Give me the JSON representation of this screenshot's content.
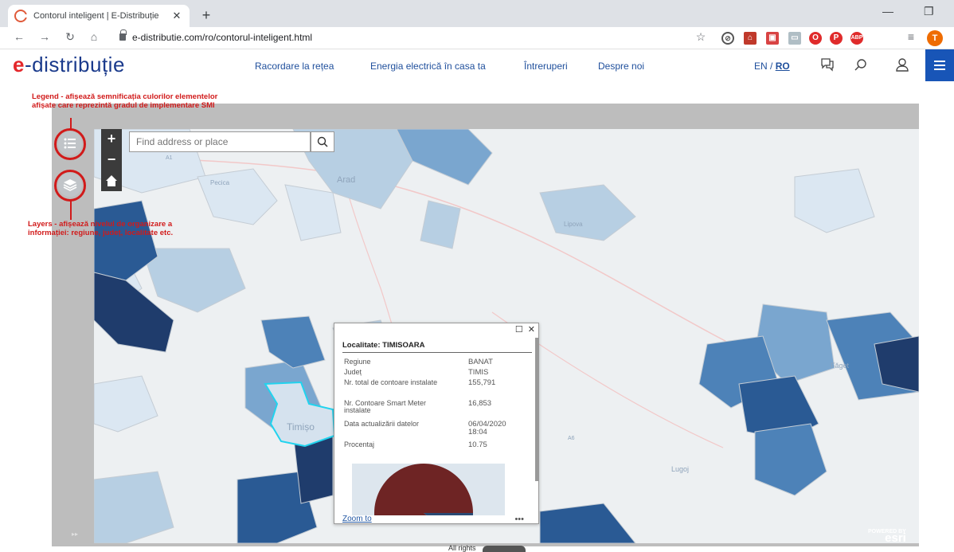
{
  "browser": {
    "tab_title": "Contorul inteligent | E-Distribuție",
    "tab_close": "✕",
    "new_tab": "+",
    "url": "e-distributie.com/ro/contorul-inteligent.html",
    "profile_initial": "T",
    "minimize": "—",
    "restore": "❐"
  },
  "site": {
    "logo_e": "e",
    "logo_rest": "-distribuție",
    "nav": [
      "Racordare la rețea",
      "Energia electrică în casa ta",
      "Întreruperi",
      "Despre noi"
    ],
    "lang_en": "EN",
    "lang_sep": " / ",
    "lang_ro": "RO"
  },
  "annotations": {
    "legend": "Legend - afișează semnificația culorilor elementelor afișate care reprezintă gradul de implementare SMI",
    "layers": "Layers - afișează nivelul de organizare a informației: regiune, județ, localitate etc."
  },
  "map": {
    "search_placeholder": "Find address or place",
    "zoom_in": "+",
    "zoom_out": "−",
    "place_labels": [
      "Arad",
      "Timișo",
      "Pecica",
      "Lipova",
      "Lugoj",
      "Făget",
      "A1",
      "A6"
    ],
    "footer": "All rights",
    "esri_powered": "POWERED BY",
    "esri_name": "esri",
    "expand_glyph": "▸▸"
  },
  "popup": {
    "title": "Localitate: TIMISOARA",
    "rows": [
      {
        "label": "Regiune",
        "value": "BANAT"
      },
      {
        "label": "Județ",
        "value": "TIMIS"
      },
      {
        "label": "Nr. total de contoare instalate",
        "value": "155,791"
      },
      {
        "label": "Nr. Contoare Smart Meter instalate",
        "value": "16,853"
      },
      {
        "label": "Data actualizării datelor",
        "value": "06/04/2020 18:04"
      },
      {
        "label": "Procentaj",
        "value": "10.75"
      }
    ],
    "zoom_to": "Zoom to",
    "more": "•••",
    "maximize": "☐",
    "close": "✕"
  },
  "colors": {
    "brand_blue": "#1a3a8c",
    "brand_red": "#e4272b",
    "annotation_red": "#d11a1a",
    "choropleth": [
      "#dbe7f2",
      "#b7cfe3",
      "#7aa6cf",
      "#4d82b8",
      "#2a5a94",
      "#1f3c6c"
    ],
    "pie_main": "#6e2424",
    "pie_slice": "#2a4a74"
  },
  "pie_share_percent": 10.75
}
